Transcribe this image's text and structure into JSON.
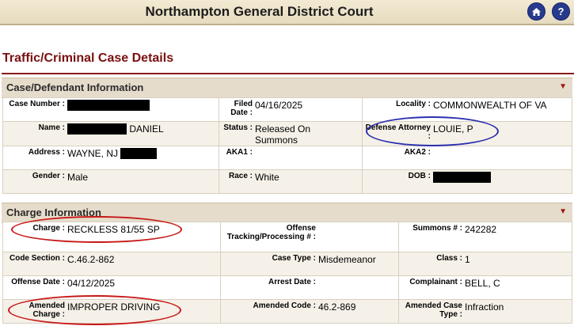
{
  "court": {
    "title": "Northampton General District Court"
  },
  "page": {
    "title": "Traffic/Criminal Case Details"
  },
  "icons": {
    "home": "home-icon",
    "help": "help-icon",
    "collapse": "collapse-arrow-icon"
  },
  "colors": {
    "title": "#7a1010",
    "header_bg": "#e6dccb",
    "row_alt": "#f5f1e8",
    "highlight_red": "#c81818",
    "highlight_blue": "#2a2fb0"
  },
  "case_section": {
    "header": "Case/Defendant Information",
    "case_number_label": "Case Number :",
    "filed_date_label": "Filed Date :",
    "filed_date": "04/16/2025",
    "locality_label": "Locality :",
    "locality": "COMMONWEALTH OF VA",
    "name_label": "Name :",
    "name_suffix": "DANIEL",
    "status_label": "Status :",
    "status": "Released On Summons",
    "defense_label": "Defense Attorney :",
    "defense": "LOUIE, P",
    "address_label": "Address :",
    "address": "WAYNE, NJ",
    "aka1_label": "AKA1 :",
    "aka2_label": "AKA2 :",
    "gender_label": "Gender :",
    "gender": "Male",
    "race_label": "Race :",
    "race": "White",
    "dob_label": "DOB :"
  },
  "charge_section": {
    "header": "Charge Information",
    "charge_label": "Charge :",
    "charge": "RECKLESS 81/55 SP",
    "tracking_label": "Offense Tracking/Processing # :",
    "summons_label": "Summons # :",
    "summons": "242282",
    "code_section_label": "Code Section :",
    "code_section": "C.46.2-862",
    "case_type_label": "Case Type :",
    "case_type": "Misdemeanor",
    "class_label": "Class :",
    "class": "1",
    "offense_date_label": "Offense Date :",
    "offense_date": "04/12/2025",
    "arrest_date_label": "Arrest Date :",
    "complainant_label": "Complainant :",
    "complainant": "BELL, C",
    "amended_charge_label": "Amended Charge :",
    "amended_charge": "IMPROPER DRIVING",
    "amended_code_label": "Amended Code :",
    "amended_code": "46.2-869",
    "amended_case_type_label": "Amended Case Type :",
    "amended_case_type": "Infraction"
  }
}
